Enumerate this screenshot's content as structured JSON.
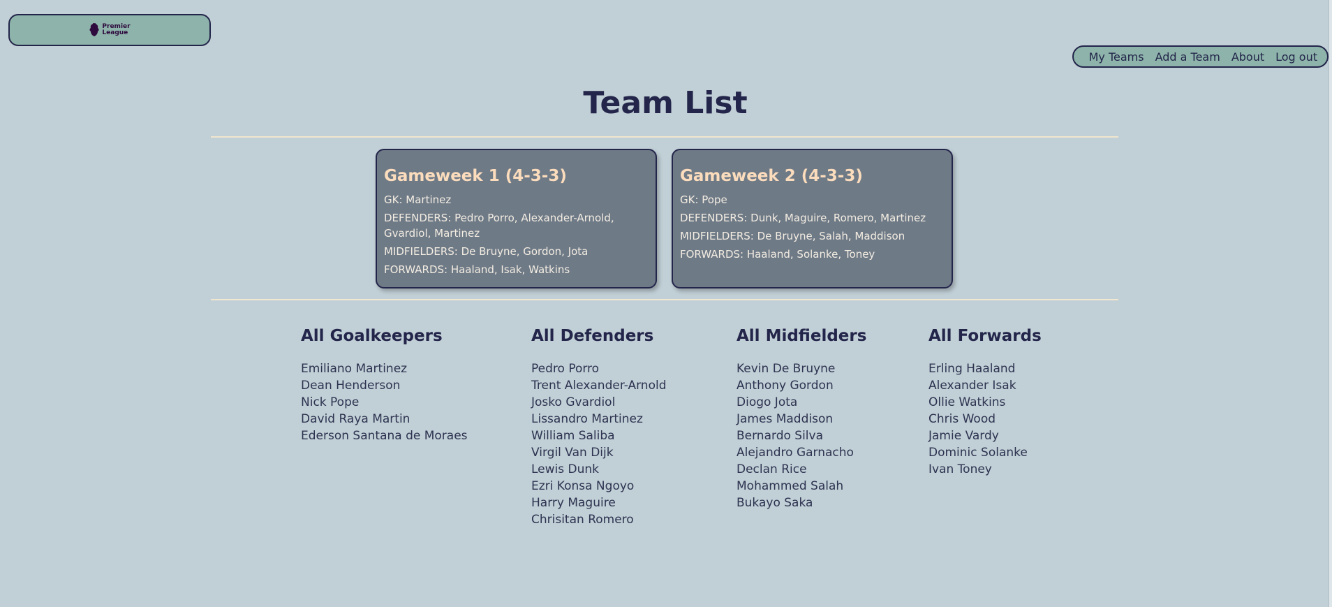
{
  "logo": {
    "line1": "Premier",
    "line2": "League"
  },
  "nav": {
    "items": [
      "My Teams",
      "Add a Team",
      "About",
      "Log out"
    ]
  },
  "page": {
    "title": "Team List"
  },
  "teams": [
    {
      "title": "Gameweek 1 (4-3-3)",
      "gk": "GK: Martinez",
      "defenders": "DEFENDERS: Pedro Porro, Alexander-Arnold, Gvardiol, Martinez",
      "midfielders": "MIDFIELDERS: De Bruyne, Gordon, Jota",
      "forwards": "FORWARDS: Haaland, Isak, Watkins"
    },
    {
      "title": "Gameweek 2 (4-3-3)",
      "gk": "GK: Pope",
      "defenders": "DEFENDERS: Dunk, Maguire, Romero, Martinez",
      "midfielders": "MIDFIELDERS: De Bruyne, Salah, Maddison",
      "forwards": "FORWARDS: Haaland, Solanke, Toney"
    }
  ],
  "players": {
    "goalkeepers": {
      "heading": "All Goalkeepers",
      "names": [
        "Emiliano Martinez",
        "Dean Henderson",
        "Nick Pope",
        "David Raya Martin",
        "Ederson Santana de Moraes"
      ]
    },
    "defenders": {
      "heading": "All Defenders",
      "names": [
        "Pedro Porro",
        "Trent Alexander-Arnold",
        "Josko Gvardiol",
        "Lissandro Martinez",
        "William Saliba",
        "Virgil Van Dijk",
        "Lewis Dunk",
        "Ezri Konsa Ngoyo",
        "Harry Maguire",
        "Chrisitan Romero"
      ]
    },
    "midfielders": {
      "heading": "All Midfielders",
      "names": [
        "Kevin De Bruyne",
        "Anthony Gordon",
        "Diogo Jota",
        "James Maddison",
        "Bernardo Silva",
        "Alejandro Garnacho",
        "Declan Rice",
        "Mohammed Salah",
        "Bukayo Saka"
      ]
    },
    "forwards": {
      "heading": "All Forwards",
      "names": [
        "Erling Haaland",
        "Alexander Isak",
        "Ollie Watkins",
        "Chris Wood",
        "Jamie Vardy",
        "Dominic Solanke",
        "Ivan Toney"
      ]
    }
  },
  "colors": {
    "background": "#c1cfd6",
    "accent": "#8db3aa",
    "navy": "#23254a",
    "card": "#6f7a87",
    "card_title": "#fbdcbc",
    "divider": "#f1e6cf"
  }
}
